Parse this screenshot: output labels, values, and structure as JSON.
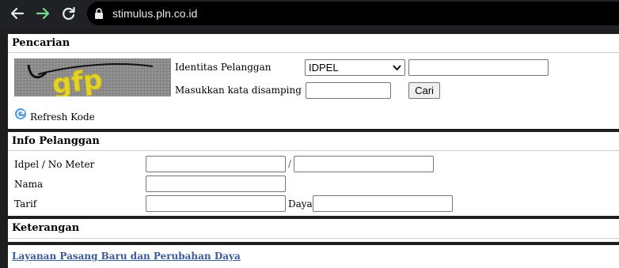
{
  "browser": {
    "url": "stimulus.pln.co.id"
  },
  "search": {
    "title": "Pencarian",
    "captcha_text": "gfp",
    "customer_id_label": "Identitas Pelanggan",
    "id_type_selected": "IDPEL",
    "id_value": "",
    "captcha_label": "Masukkan kata disamping",
    "captcha_value": "",
    "search_button": "Cari",
    "refresh_label": "Refresh Kode"
  },
  "info": {
    "title": "Info Pelanggan",
    "idpel_label": "Idpel / No Meter",
    "slash": "/",
    "idpel_value": "",
    "meter_value": "",
    "name_label": "Nama",
    "name_value": "",
    "tarif_label": "Tarif",
    "tarif_value": "",
    "daya_label": "Daya",
    "daya_value": ""
  },
  "notes": {
    "title": "Keterangan"
  },
  "footer": {
    "link_text": "Layanan Pasang Baru dan Perubahan Daya"
  },
  "colors": {
    "chrome_bg": "#202124",
    "link": "#3b5a98",
    "forward_arrow": "#7cd992"
  }
}
